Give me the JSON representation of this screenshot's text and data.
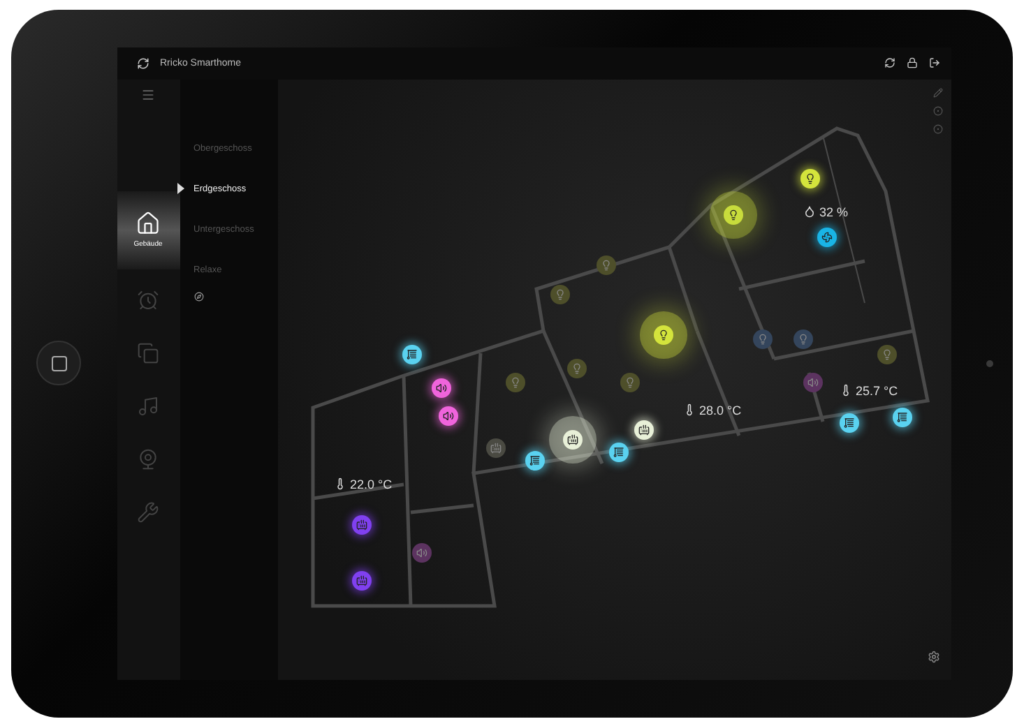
{
  "app": {
    "title": "Rricko Smarthome"
  },
  "nav": [
    {
      "kind": "house",
      "label": "Gebäude",
      "selected": true
    },
    {
      "kind": "clock",
      "selected": false
    },
    {
      "kind": "pages",
      "selected": false
    },
    {
      "kind": "music",
      "selected": false
    },
    {
      "kind": "camera",
      "selected": false
    },
    {
      "kind": "wrench",
      "selected": false
    }
  ],
  "floors": [
    {
      "label": "Obergeschoss",
      "selected": false
    },
    {
      "label": "Erdgeschoss",
      "selected": true
    },
    {
      "label": "Untergeschoss",
      "selected": false
    },
    {
      "label": "Relaxe",
      "selected": false
    }
  ],
  "readings": [
    {
      "kind": "humidity",
      "value": "32 %"
    },
    {
      "kind": "temperature",
      "value": "25.7 °C"
    },
    {
      "kind": "temperature",
      "value": "28.0 °C"
    },
    {
      "kind": "temperature",
      "value": "22.0 °C"
    }
  ],
  "devices": [
    {
      "kind": "light",
      "on": true,
      "color": "#c8dc3c"
    },
    {
      "kind": "light",
      "on": true,
      "color": "#d4e43c"
    },
    {
      "kind": "fan",
      "on": true,
      "color": "#19b4e6"
    },
    {
      "kind": "light",
      "on": false,
      "color": "#4e4f2a"
    },
    {
      "kind": "light",
      "on": false,
      "color": "#4e4f2a"
    },
    {
      "kind": "light",
      "on": true,
      "color": "#d4e43c"
    },
    {
      "kind": "light",
      "on": false,
      "color": "#34455c"
    },
    {
      "kind": "light",
      "on": false,
      "color": "#34455c"
    },
    {
      "kind": "light",
      "on": false,
      "color": "#4e4f2a"
    },
    {
      "kind": "speaker",
      "on": false,
      "color": "#5c3360"
    },
    {
      "kind": "blinds",
      "on": true,
      "color": "#5ad2f0"
    },
    {
      "kind": "speaker",
      "on": true,
      "color": "#f064dc"
    },
    {
      "kind": "speaker",
      "on": true,
      "color": "#f064dc"
    },
    {
      "kind": "light",
      "on": false,
      "color": "#4e4f2a"
    },
    {
      "kind": "light",
      "on": false,
      "color": "#4e4f2a"
    },
    {
      "kind": "light",
      "on": false,
      "color": "#4e4f2a"
    },
    {
      "kind": "heater",
      "on": true,
      "color": "#e8f0d8"
    },
    {
      "kind": "heater",
      "on": false,
      "color": "#4a4a42"
    },
    {
      "kind": "heater",
      "on": true,
      "color": "#e8f0d8"
    },
    {
      "kind": "blinds",
      "on": true,
      "color": "#5ad2f0"
    },
    {
      "kind": "blinds",
      "on": true,
      "color": "#5ad2f0"
    },
    {
      "kind": "blinds",
      "on": true,
      "color": "#5ad2f0"
    },
    {
      "kind": "blinds",
      "on": true,
      "color": "#5ad2f0"
    },
    {
      "kind": "heater",
      "on": true,
      "color": "#8040f0"
    },
    {
      "kind": "heater",
      "on": true,
      "color": "#8040f0"
    },
    {
      "kind": "speaker",
      "on": false,
      "color": "#5c3360"
    }
  ]
}
